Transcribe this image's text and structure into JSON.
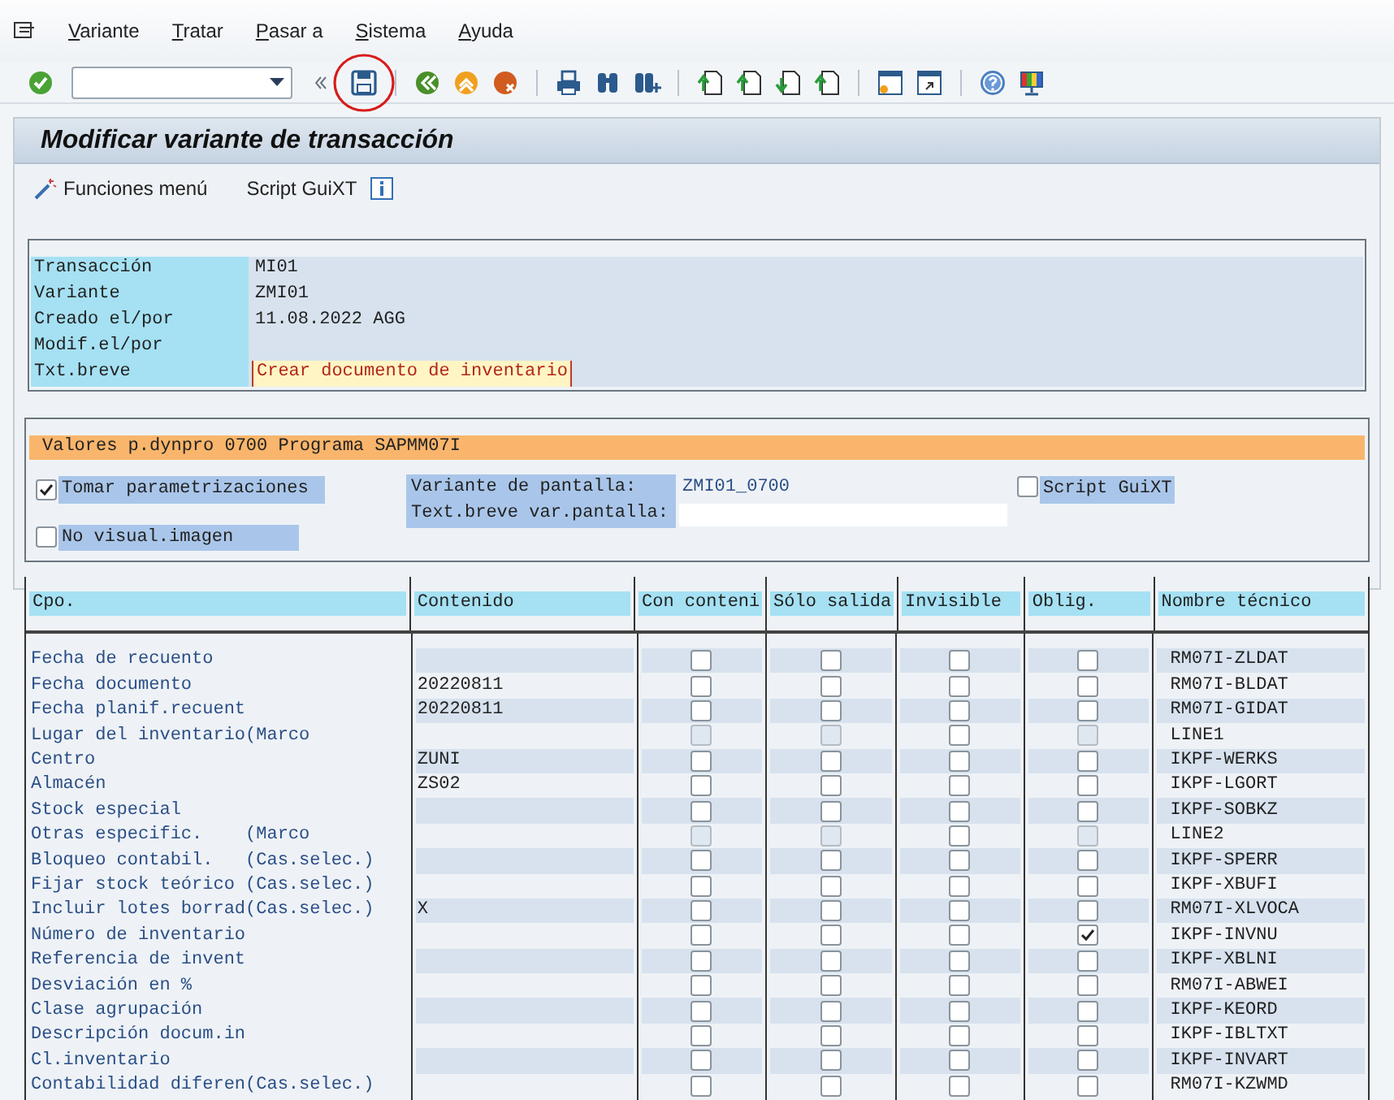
{
  "menu": [
    {
      "label": "Variante"
    },
    {
      "label": "Tratar"
    },
    {
      "label": "Pasar a"
    },
    {
      "label": "Sistema"
    },
    {
      "label": "Ayuda"
    }
  ],
  "toolbar": {
    "save_circled": true
  },
  "title": "Modificar variante de transacción",
  "app_toolbar": [
    {
      "label": "Funciones menú"
    },
    {
      "label": "Script GuiXT"
    }
  ],
  "header": [
    {
      "label": "Transacción",
      "value": "MI01",
      "kind": "text"
    },
    {
      "label": "Variante",
      "value": "ZMI01",
      "kind": "text"
    },
    {
      "label": "Creado el/por",
      "value": "11.08.2022 AGG",
      "kind": "text"
    },
    {
      "label": "Modif.el/por",
      "kind": "text"
    },
    {
      "label": "Txt.breve",
      "value": "Crear documento de inventario",
      "kind": "input"
    }
  ],
  "section": {
    "title": "Valores p.dynpro 0700 Programa SAPMM07I",
    "tomar": {
      "label": "Tomar parametrizaciones",
      "checked": true
    },
    "no_visual": {
      "label": "No visual.imagen",
      "checked": false
    },
    "script": {
      "label": "Script GuiXT",
      "checked": false
    },
    "variante_label": "Variante de pantalla:",
    "variante_value": "ZMI01_0700",
    "texto_label": "Text.breve var.pantalla:"
  },
  "table": {
    "columns": [
      "Cpo.",
      "Contenido",
      "Con conteni",
      "Sólo salida",
      "Invisible",
      "Oblig.",
      "Nombre técnico"
    ],
    "rows": [
      {
        "field": "Fecha de recuento",
        "flags": [
          {
            "checked": false,
            "disabled": false
          },
          {
            "checked": false,
            "disabled": false
          },
          {
            "checked": false,
            "disabled": false
          },
          {
            "checked": false,
            "disabled": false
          }
        ],
        "tech": "RM07I-ZLDAT"
      },
      {
        "field": "Fecha documento",
        "content": "20220811",
        "flags": [
          {
            "checked": false,
            "disabled": false
          },
          {
            "checked": false,
            "disabled": false
          },
          {
            "checked": false,
            "disabled": false
          },
          {
            "checked": false,
            "disabled": false
          }
        ],
        "tech": "RM07I-BLDAT"
      },
      {
        "field": "Fecha planif.recuent",
        "content": "20220811",
        "flags": [
          {
            "checked": false,
            "disabled": false
          },
          {
            "checked": false,
            "disabled": false
          },
          {
            "checked": false,
            "disabled": false
          },
          {
            "checked": false,
            "disabled": false
          }
        ],
        "tech": "RM07I-GIDAT"
      },
      {
        "field": "Lugar del inventario(Marco",
        "flags": [
          {
            "checked": false,
            "disabled": true
          },
          {
            "checked": false,
            "disabled": true
          },
          {
            "checked": false,
            "disabled": false
          },
          {
            "checked": false,
            "disabled": true
          }
        ],
        "tech": "LINE1"
      },
      {
        "field": "Centro",
        "content": "ZUNI",
        "flags": [
          {
            "checked": false,
            "disabled": false
          },
          {
            "checked": false,
            "disabled": false
          },
          {
            "checked": false,
            "disabled": false
          },
          {
            "checked": false,
            "disabled": false
          }
        ],
        "tech": "IKPF-WERKS"
      },
      {
        "field": "Almacén",
        "content": "ZS02",
        "flags": [
          {
            "checked": false,
            "disabled": false
          },
          {
            "checked": false,
            "disabled": false
          },
          {
            "checked": false,
            "disabled": false
          },
          {
            "checked": false,
            "disabled": false
          }
        ],
        "tech": "IKPF-LGORT"
      },
      {
        "field": "Stock especial",
        "flags": [
          {
            "checked": false,
            "disabled": false
          },
          {
            "checked": false,
            "disabled": false
          },
          {
            "checked": false,
            "disabled": false
          },
          {
            "checked": false,
            "disabled": false
          }
        ],
        "tech": "IKPF-SOBKZ"
      },
      {
        "field": "Otras especific.    (Marco",
        "flags": [
          {
            "checked": false,
            "disabled": true
          },
          {
            "checked": false,
            "disabled": true
          },
          {
            "checked": false,
            "disabled": false
          },
          {
            "checked": false,
            "disabled": true
          }
        ],
        "tech": "LINE2"
      },
      {
        "field": "Bloqueo contabil.   (Cas.selec.)",
        "flags": [
          {
            "checked": false,
            "disabled": false
          },
          {
            "checked": false,
            "disabled": false
          },
          {
            "checked": false,
            "disabled": false
          },
          {
            "checked": false,
            "disabled": false
          }
        ],
        "tech": "IKPF-SPERR"
      },
      {
        "field": "Fijar stock teórico (Cas.selec.)",
        "flags": [
          {
            "checked": false,
            "disabled": false
          },
          {
            "checked": false,
            "disabled": false
          },
          {
            "checked": false,
            "disabled": false
          },
          {
            "checked": false,
            "disabled": false
          }
        ],
        "tech": "IKPF-XBUFI"
      },
      {
        "field": "Incluir lotes borrad(Cas.selec.)",
        "content": "X",
        "flags": [
          {
            "checked": false,
            "disabled": false
          },
          {
            "checked": false,
            "disabled": false
          },
          {
            "checked": false,
            "disabled": false
          },
          {
            "checked": false,
            "disabled": false
          }
        ],
        "tech": "RM07I-XLVOCA"
      },
      {
        "field": "Número de inventario",
        "flags": [
          {
            "checked": false,
            "disabled": false
          },
          {
            "checked": false,
            "disabled": false
          },
          {
            "checked": false,
            "disabled": false
          },
          {
            "checked": true,
            "disabled": false
          }
        ],
        "tech": "IKPF-INVNU"
      },
      {
        "field": "Referencia de invent",
        "flags": [
          {
            "checked": false,
            "disabled": false
          },
          {
            "checked": false,
            "disabled": false
          },
          {
            "checked": false,
            "disabled": false
          },
          {
            "checked": false,
            "disabled": false
          }
        ],
        "tech": "IKPF-XBLNI"
      },
      {
        "field": "Desviación en %",
        "flags": [
          {
            "checked": false,
            "disabled": false
          },
          {
            "checked": false,
            "disabled": false
          },
          {
            "checked": false,
            "disabled": false
          },
          {
            "checked": false,
            "disabled": false
          }
        ],
        "tech": "RM07I-ABWEI"
      },
      {
        "field": "Clase agrupación",
        "flags": [
          {
            "checked": false,
            "disabled": false
          },
          {
            "checked": false,
            "disabled": false
          },
          {
            "checked": false,
            "disabled": false
          },
          {
            "checked": false,
            "disabled": false
          }
        ],
        "tech": "IKPF-KEORD"
      },
      {
        "field": "Descripción docum.in",
        "flags": [
          {
            "checked": false,
            "disabled": false
          },
          {
            "checked": false,
            "disabled": false
          },
          {
            "checked": false,
            "disabled": false
          },
          {
            "checked": false,
            "disabled": false
          }
        ],
        "tech": "IKPF-IBLTXT"
      },
      {
        "field": "Cl.inventario",
        "flags": [
          {
            "checked": false,
            "disabled": false
          },
          {
            "checked": false,
            "disabled": false
          },
          {
            "checked": false,
            "disabled": false
          },
          {
            "checked": false,
            "disabled": false
          }
        ],
        "tech": "IKPF-INVART"
      },
      {
        "field": "Contabilidad diferen(Cas.selec.)",
        "flags": [
          {
            "checked": false,
            "disabled": false
          },
          {
            "checked": false,
            "disabled": false
          },
          {
            "checked": false,
            "disabled": false
          },
          {
            "checked": false,
            "disabled": false
          }
        ],
        "tech": "RM07I-KZWMD"
      }
    ]
  }
}
